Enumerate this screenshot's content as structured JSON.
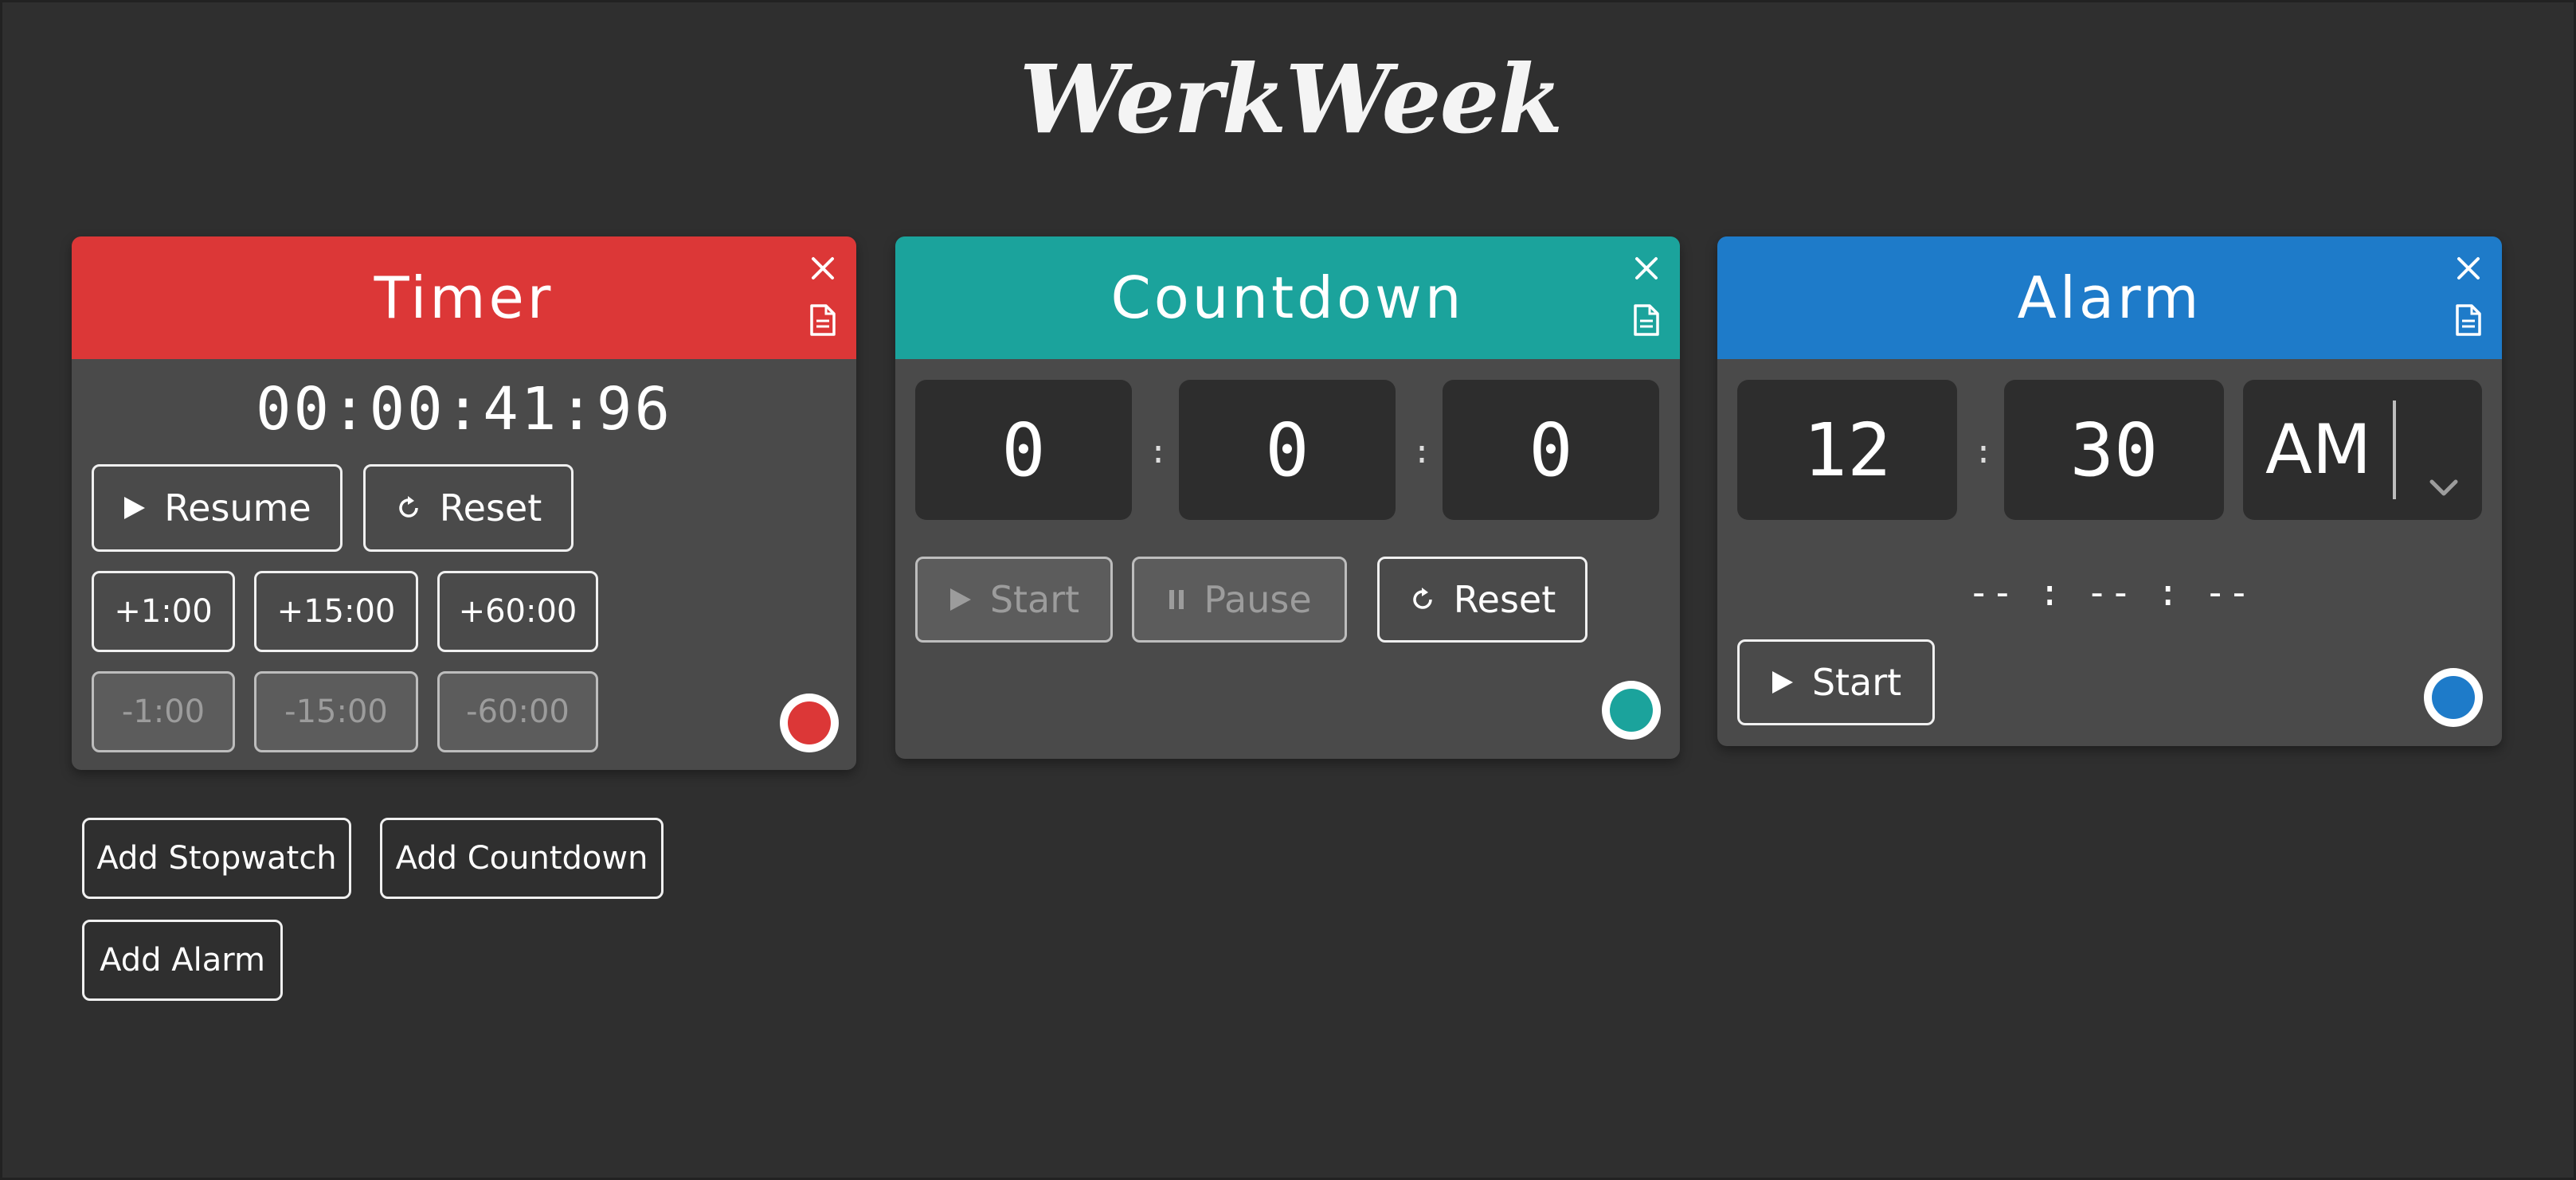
{
  "app": {
    "title": "WerkWeek"
  },
  "colors": {
    "background": "#2f2f2f",
    "card_body": "#4a4a4a",
    "timer_accent": "#dc3737",
    "countdown_accent": "#1ba39c",
    "alarm_accent": "#1e7bc9",
    "timebox": "#2d2d2d"
  },
  "timer": {
    "title": "Timer",
    "display": "00:00:41:96",
    "resume_label": "Resume",
    "reset_label": "Reset",
    "add_buttons": [
      "+1:00",
      "+15:00",
      "+60:00"
    ],
    "sub_buttons": [
      "-1:00",
      "-15:00",
      "-60:00"
    ],
    "icons": {
      "close": "close-icon",
      "notes": "document-icon",
      "resume": "play-icon",
      "reset": "refresh-icon"
    }
  },
  "countdown": {
    "title": "Countdown",
    "hours": "0",
    "minutes": "0",
    "seconds": "0",
    "separator": ":",
    "start_label": "Start",
    "pause_label": "Pause",
    "reset_label": "Reset",
    "icons": {
      "close": "close-icon",
      "notes": "document-icon",
      "start": "play-icon",
      "pause": "pause-icon",
      "reset": "refresh-icon"
    }
  },
  "alarm": {
    "title": "Alarm",
    "hour": "12",
    "minute": "30",
    "period": "AM",
    "separator": ":",
    "remaining": "-- : -- : --",
    "start_label": "Start",
    "icons": {
      "close": "close-icon",
      "notes": "document-icon",
      "start": "play-icon",
      "period_dropdown": "chevron-down-icon"
    }
  },
  "actions": {
    "add_stopwatch": "Add Stopwatch",
    "add_countdown": "Add Countdown",
    "add_alarm": "Add Alarm"
  }
}
